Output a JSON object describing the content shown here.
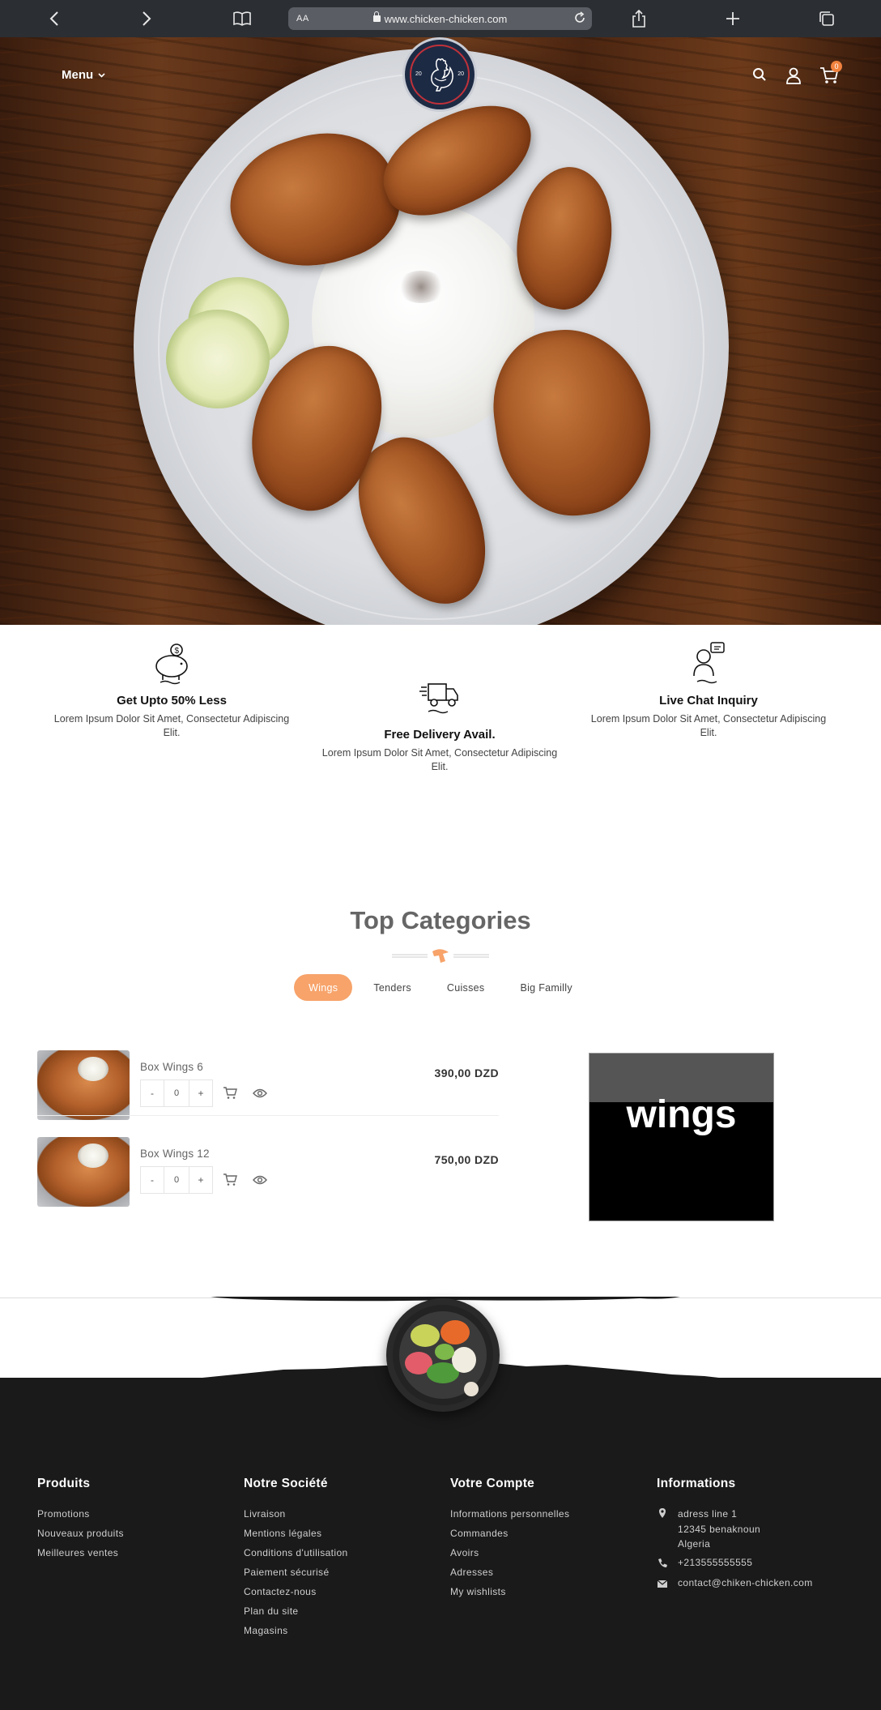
{
  "browser": {
    "aa_label": "AA",
    "url": "www.chicken-chicken.com"
  },
  "header": {
    "menu_label": "Menu",
    "logo_year_left": "20",
    "logo_year_right": "20",
    "cart_count": "0"
  },
  "features": [
    {
      "title": "Get Upto 50% Less",
      "text": "Lorem Ipsum Dolor Sit Amet, Consectetur Adipiscing Elit.",
      "icon": "piggy-bank-icon"
    },
    {
      "title": "Free Delivery Avail.",
      "text": "Lorem Ipsum Dolor Sit Amet, Consectetur Adipiscing Elit.",
      "icon": "delivery-truck-icon"
    },
    {
      "title": "Live Chat Inquiry",
      "text": "Lorem Ipsum Dolor Sit Amet, Consectetur Adipiscing Elit.",
      "icon": "chat-support-icon"
    }
  ],
  "categories": {
    "title": "Top Categories",
    "tabs": [
      "Wings",
      "Tenders",
      "Cuisses",
      "Big Familly"
    ],
    "active_tab": "Wings",
    "products": [
      {
        "name": "Box Wings 6",
        "qty": "0",
        "price": "390,00 DZD",
        "minus": "-",
        "plus": "+"
      },
      {
        "name": "Box Wings 12",
        "qty": "0",
        "price": "750,00 DZD",
        "minus": "-",
        "plus": "+"
      }
    ],
    "banner_word": "wings"
  },
  "footer": {
    "produits": {
      "title": "Produits",
      "links": [
        "Promotions",
        "Nouveaux produits",
        "Meilleures ventes"
      ]
    },
    "societe": {
      "title": "Notre Société",
      "links": [
        "Livraison",
        "Mentions légales",
        "Conditions d'utilisation",
        "Paiement sécurisé",
        "Contactez-nous",
        "Plan du site",
        "Magasins"
      ]
    },
    "compte": {
      "title": "Votre Compte",
      "links": [
        "Informations personnelles",
        "Commandes",
        "Avoirs",
        "Adresses",
        "My wishlists"
      ]
    },
    "informations": {
      "title": "Informations",
      "address_line1": "adress line 1",
      "address_line2": "12345 benaknoun",
      "address_line3": "Algeria",
      "phone": "+213555555555",
      "email": "contact@chiken-chicken.com"
    }
  },
  "colors": {
    "accent": "#f7a36a",
    "cart_badge": "#f0823e",
    "footer_bg": "#1a1a1b",
    "browser_bar": "#2b2e33"
  }
}
